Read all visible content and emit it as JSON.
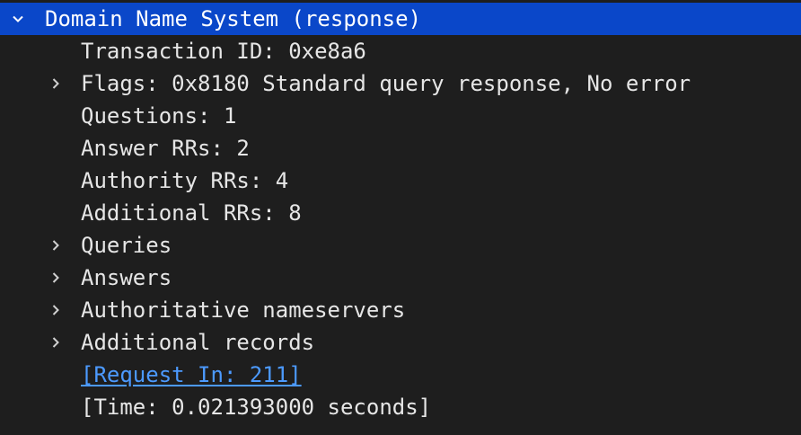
{
  "tree": {
    "root_label": "Domain Name System (response)",
    "transaction_id": "Transaction ID: 0xe8a6",
    "flags": "Flags: 0x8180 Standard query response, No error",
    "questions": "Questions: 1",
    "answer_rrs": "Answer RRs: 2",
    "authority_rrs": "Authority RRs: 4",
    "additional_rrs": "Additional RRs: 8",
    "queries": "Queries",
    "answers": "Answers",
    "authoritative_nameservers": "Authoritative nameservers",
    "additional_records": "Additional records",
    "request_in": "[Request In: 211]",
    "time": "[Time: 0.021393000 seconds]"
  },
  "icons": {
    "expanded": "chevron-down-icon",
    "collapsed": "chevron-right-icon"
  },
  "colors": {
    "background": "#1e1e1e",
    "selection": "#0a47c9",
    "text": "#e6e6e6",
    "link": "#4c9aff"
  }
}
